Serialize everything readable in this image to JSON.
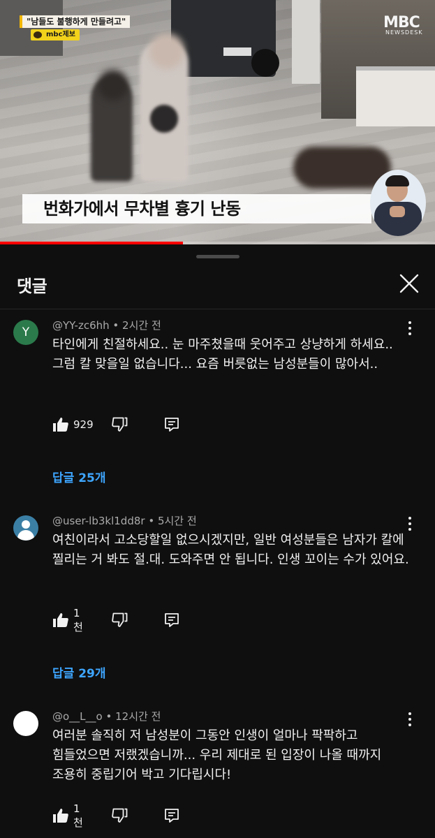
{
  "video": {
    "caption_top": "\"남들도 불행하게 만들려고\"",
    "tip_badge": "mbc제보",
    "logo": "MBC",
    "logo_sub": "NEWSDESK",
    "headline": "번화가에서 무차별 흉기 난동",
    "progress_fraction": 0.42
  },
  "sheet": {
    "title": "댓글"
  },
  "comments": [
    {
      "avatar_letter": "Y",
      "author": "@YY-zc6hh",
      "time": "2시간 전",
      "text": "타인에게 친절하세요.. 눈 마주쳤을때 웃어주고 상냥하게 하세요.. 그럼 칼 맞을일 없습니다... 요즘 버릇없는 남성분들이 많아서..",
      "likes": "929",
      "replies": "답글 25개"
    },
    {
      "avatar_letter": "",
      "author": "@user-lb3kl1dd8r",
      "time": "5시간 전",
      "text": "여친이라서 고소당할일 없으시겠지만, 일반 여성분들은 남자가 칼에 찔리는 거 봐도 절.대. 도와주면 안 됩니다. 인생 꼬이는 수가 있어요.",
      "likes": "1천",
      "replies": "답글 29개"
    },
    {
      "avatar_letter": "",
      "author": "@o__L__o",
      "time": "12시간 전",
      "text": "여러분 솔직히 저 남성분이 그동안 인생이 얼마나 팍팍하고 힘들었으면 저랬겠습니까... 우리 제대로 된 입장이 나올 때까지 조용히 중립기어 박고 기다립시다!",
      "likes": "1천",
      "replies": ""
    }
  ],
  "meta_separator": " • ",
  "colors": {
    "background": "#0f0f0f",
    "reply_link": "#3ea6ff",
    "meta_text": "#aaaaaa",
    "avatar_y": "#2b7a4b",
    "avatar_user": "#3b7fa5",
    "progress": "#ff0000"
  },
  "icons": {
    "like": "thumbs-up-icon",
    "dislike": "thumbs-down-icon",
    "reply": "reply-comment-icon",
    "more": "more-vert-icon",
    "close": "close-icon"
  }
}
